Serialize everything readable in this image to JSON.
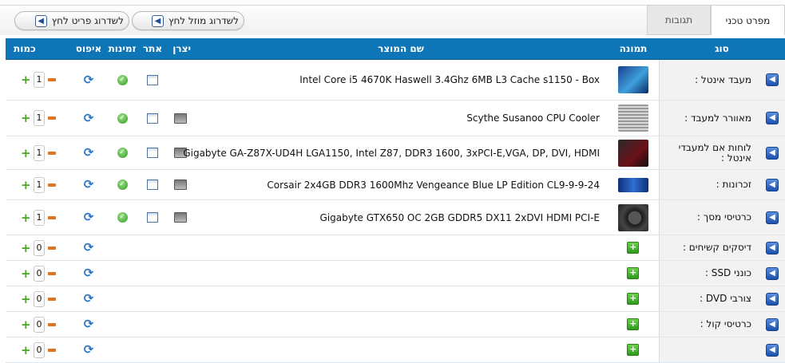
{
  "tabs": [
    {
      "label": "מפרט טכני",
      "active": true
    },
    {
      "label": "תגובות",
      "active": false
    }
  ],
  "buttons": {
    "upgrade_budget": "לשדרוג מוזל לחץ",
    "upgrade_premium": "לשדרוג פריט לחץ"
  },
  "columns": {
    "type": "סוג",
    "image": "תמונה",
    "name": "שם המוצר",
    "manufacturer": "יצרן",
    "site": "אתר",
    "availability": "זמינות",
    "reset": "איפוס",
    "quantity": "כמות"
  },
  "rows": [
    {
      "type": "מעבד אינטל :",
      "image": "cpu",
      "name": "Intel Core i5 4670K Haswell 3.4Ghz 6MB L3 Cache s1150 - Box",
      "qty": "1",
      "has_item": true,
      "has_mfr": false
    },
    {
      "type": "מאוורר למעבד :",
      "image": "cooler",
      "name": "Scythe Susanoo CPU Cooler",
      "qty": "1",
      "has_item": true,
      "has_mfr": true
    },
    {
      "type": "לוחות אם למעבדי אינטל :",
      "image": "motherboard",
      "name": "Gigabyte GA-Z87X-UD4H LGA1150, Intel Z87, DDR3 1600, 3xPCI-E,VGA, DP, DVI, HDMI",
      "qty": "1",
      "has_item": true,
      "has_mfr": true
    },
    {
      "type": "זכרונות :",
      "image": "ram",
      "name": "Corsair 2x4GB DDR3 1600Mhz Vengeance Blue LP Edition CL9-9-9-24",
      "qty": "1",
      "has_item": true,
      "has_mfr": true
    },
    {
      "type": "כרטיסי מסך :",
      "image": "gpu",
      "name": "Gigabyte GTX650 OC 2GB GDDR5 DX11 2xDVI HDMI PCI-E",
      "qty": "1",
      "has_item": true,
      "has_mfr": true
    },
    {
      "type": "דיסקים קשיחים :",
      "qty": "0",
      "has_item": false
    },
    {
      "type": "כונני SSD :",
      "qty": "0",
      "has_item": false
    },
    {
      "type": "צורבי DVD :",
      "qty": "0",
      "has_item": false
    },
    {
      "type": "כרטיסי קול :",
      "qty": "0",
      "has_item": false
    },
    {
      "type": "",
      "qty": "0",
      "has_item": false
    }
  ],
  "icons": {
    "type_arrow": "arrow-left-icon",
    "site": "window-icon",
    "manufacturer": "monitor-icon",
    "availability": "check-circle-icon",
    "reset": "refresh-icon",
    "plus": "plus-icon",
    "minus": "minus-icon",
    "add": "add-product-icon"
  },
  "colors": {
    "header_bg": "#0e75b6",
    "type_arrow": "#1d4fae",
    "available": "#2f9a1f",
    "minus": "#e2731c"
  }
}
